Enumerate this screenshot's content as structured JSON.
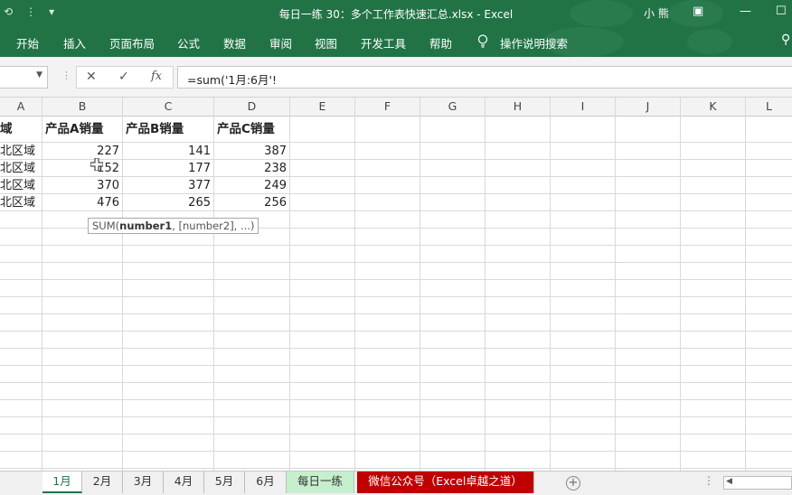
{
  "titlebar": {
    "qat_undo": "⟲",
    "qat_more": "⋮",
    "qat_customize": "▾",
    "title": "每日一练 30：多个工作表快速汇总.xlsx  -  Excel",
    "user": "小 熊",
    "restore_icon": "▣",
    "minimize_icon": "—",
    "maximize_icon": "☐"
  },
  "ribbon": {
    "tabs": [
      "开始",
      "插入",
      "页面布局",
      "公式",
      "数据",
      "审阅",
      "视图",
      "开发工具",
      "帮助"
    ],
    "tell_me": "操作说明搜索",
    "search_icon": "⚲"
  },
  "formula_bar": {
    "name_box_value": "",
    "cancel_icon": "✕",
    "enter_icon": "✓",
    "fx_label": "fx",
    "formula": "=sum('1月:6月'!"
  },
  "columns": [
    "A",
    "B",
    "C",
    "D",
    "E",
    "F",
    "G",
    "H",
    "I",
    "J",
    "K",
    "L"
  ],
  "sheet": {
    "headers": [
      "域",
      "产品A销量",
      "产品B销量",
      "产品C销量"
    ],
    "rows": [
      {
        "region": "北区域",
        "a": "227",
        "b": "141",
        "c": "387"
      },
      {
        "region": "北区域",
        "a": "152",
        "b": "177",
        "c": "238"
      },
      {
        "region": "北区域",
        "a": "370",
        "b": "377",
        "c": "249"
      },
      {
        "region": "北区域",
        "a": "476",
        "b": "265",
        "c": "256"
      }
    ],
    "tooltip_fn": "SUM(",
    "tooltip_arg1": "number1",
    "tooltip_rest": ", [number2], ...)"
  },
  "sheet_tabs": [
    {
      "label": "1月",
      "active": true
    },
    {
      "label": "2月",
      "active": false
    },
    {
      "label": "3月",
      "active": false
    },
    {
      "label": "4月",
      "active": false
    },
    {
      "label": "5月",
      "active": false
    },
    {
      "label": "6月",
      "active": false
    },
    {
      "label": "每日一练",
      "active": false
    },
    {
      "label": "微信公众号（Excel卓越之道）",
      "active": false
    }
  ],
  "sheet_controls": {
    "add_icon": "+",
    "more_dots": "⋮",
    "scroll_left": "◀"
  },
  "colors": {
    "accent": "#217346",
    "special_tab": "#c00000",
    "green_tab": "#c6efce"
  }
}
